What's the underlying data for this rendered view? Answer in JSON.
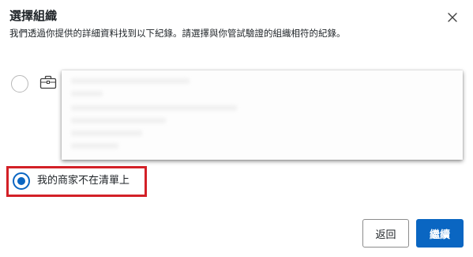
{
  "dialog": {
    "title": "選擇組織",
    "subtitle": "我們透過你提供的詳細資料找到以下紀錄。請選擇與你管試驗證的組織相符的紀錄。",
    "close_icon": "close-icon"
  },
  "options": {
    "organization_icon": "briefcase-icon",
    "none_label": "我的商家不在清單上",
    "selected": "none"
  },
  "footer": {
    "back_label": "返回",
    "continue_label": "繼續"
  },
  "colors": {
    "accent": "#0a66c2",
    "highlight": "#d32027"
  }
}
